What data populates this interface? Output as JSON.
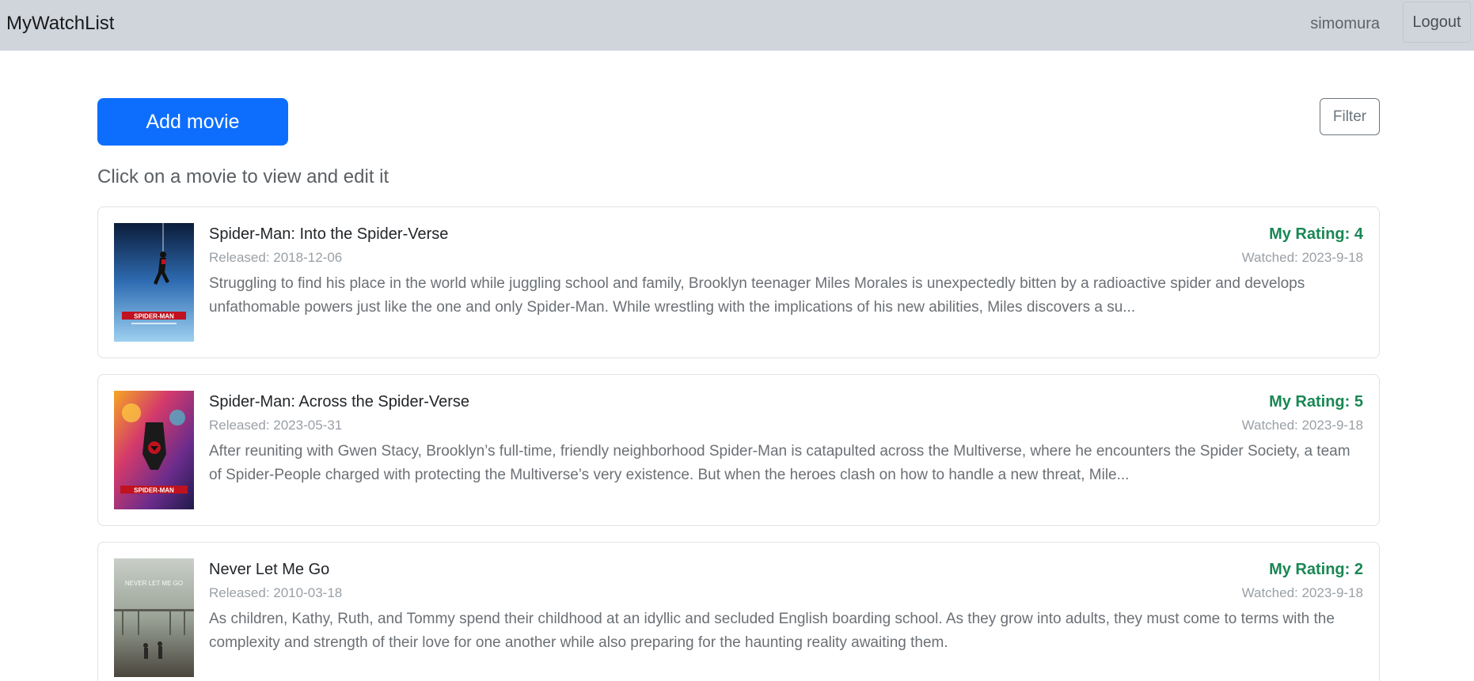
{
  "navbar": {
    "brand": "MyWatchList",
    "username": "simomura",
    "logout_label": "Logout"
  },
  "toolbar": {
    "add_label": "Add movie",
    "filter_label": "Filter"
  },
  "hint": "Click on a movie to view and edit it",
  "movies": [
    {
      "title": "Spider-Man: Into the Spider-Verse",
      "released": "Released: 2018-12-06",
      "rating": "My Rating: 4",
      "watched": "Watched: 2023-9-18",
      "description": "Struggling to find his place in the world while juggling school and family, Brooklyn teenager Miles Morales is unexpectedly bitten by a radioactive spider and develops unfathomable powers just like the one and only Spider-Man. While wrestling with the implications of his new abilities, Miles discovers a su..."
    },
    {
      "title": "Spider-Man: Across the Spider-Verse",
      "released": "Released: 2023-05-31",
      "rating": "My Rating: 5",
      "watched": "Watched: 2023-9-18",
      "description": "After reuniting with Gwen Stacy, Brooklyn’s full-time, friendly neighborhood Spider-Man is catapulted across the Multiverse, where he encounters the Spider Society, a team of Spider-People charged with protecting the Multiverse’s very existence. But when the heroes clash on how to handle a new threat, Mile..."
    },
    {
      "title": "Never Let Me Go",
      "released": "Released: 2010-03-18",
      "rating": "My Rating: 2",
      "watched": "Watched: 2023-9-18",
      "description": "As children, Kathy, Ruth, and Tommy spend their childhood at an idyllic and secluded English boarding school. As they grow into adults, they must come to terms with the complexity and strength of their love for one another while also preparing for the haunting reality awaiting them."
    }
  ],
  "posters": {
    "poster_0_text": "SPIDER-MAN",
    "poster_1_text": "SPIDER-MAN",
    "poster_2_text": "NEVER LET ME GO"
  },
  "colors": {
    "accent": "#0d6efd",
    "rating": "#198754",
    "navbar": "#d0d5dc"
  }
}
